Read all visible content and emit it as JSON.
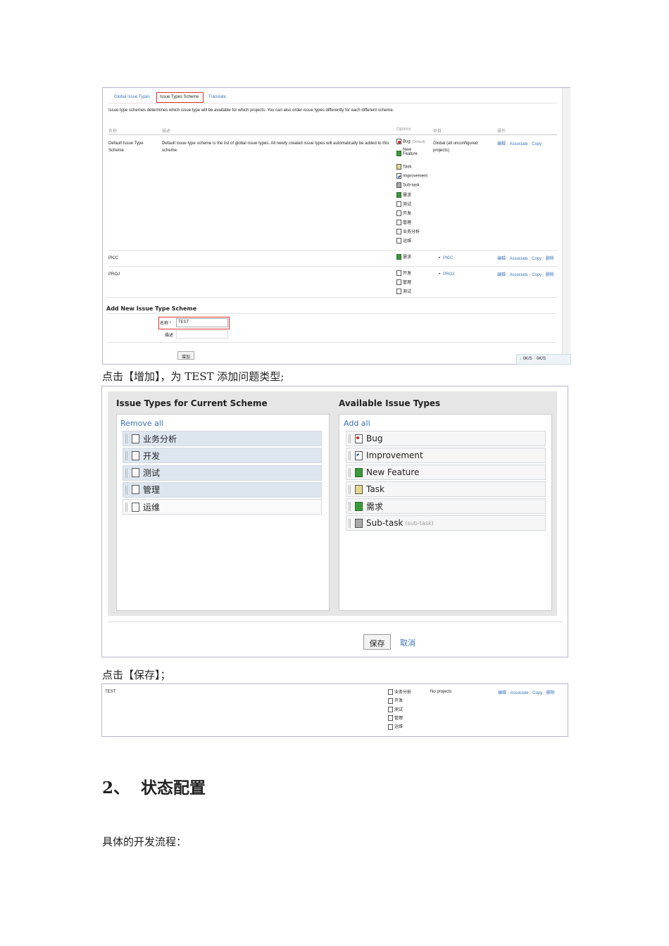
{
  "shot1": {
    "tabs": [
      "Global Issue Types",
      "Issue Types Scheme",
      "Translate"
    ],
    "description": "Issue type schemes determines which issue type will be available for which projects. You can also order issue types differently for each different scheme.",
    "headers": [
      "名称",
      "描述",
      "Options",
      "项目",
      "操作"
    ],
    "rows": [
      {
        "name": "Default Issue Type Scheme",
        "desc": "Default issue type scheme is the list of global issue types. All newly created issue types will automatically be added to this scheme.",
        "options": [
          {
            "icon": "bug",
            "label": "Bug",
            "note": "(Default)"
          },
          {
            "icon": "feat",
            "label": "New Feature"
          },
          {
            "icon": "task",
            "label": "Task"
          },
          {
            "icon": "imp",
            "label": "Improvement"
          },
          {
            "icon": "sub",
            "label": "Sub-task"
          },
          {
            "icon": "feat",
            "label": "需求"
          },
          {
            "icon": "gen",
            "label": "测试"
          },
          {
            "icon": "gen",
            "label": "开发"
          },
          {
            "icon": "gen",
            "label": "管理"
          },
          {
            "icon": "gen",
            "label": "业务分析"
          },
          {
            "icon": "gen",
            "label": "运维"
          }
        ],
        "project": "Global (all unconfigured projects)",
        "actions": [
          "编辑",
          "Associate",
          "Copy"
        ]
      },
      {
        "name": "PICC",
        "desc": "",
        "options": [
          {
            "icon": "feat",
            "label": "需求"
          }
        ],
        "project": "PICC",
        "actions": [
          "编辑",
          "Associate",
          "Copy",
          "删除"
        ]
      },
      {
        "name": "PROJ",
        "desc": "",
        "options": [
          {
            "icon": "gen",
            "label": "开发"
          },
          {
            "icon": "gen",
            "label": "管理"
          },
          {
            "icon": "gen",
            "label": "测试"
          }
        ],
        "project": "PROJ",
        "actions": [
          "编辑",
          "Associate",
          "Copy",
          "删除"
        ]
      }
    ],
    "add_title": "Add New Issue Type Scheme",
    "name_label": "名称 *",
    "name_value": "TEST",
    "desc_label": "描述",
    "add_button": "增加",
    "status": {
      "down": "0K/S",
      "up": "0K/S"
    }
  },
  "caption1": "点击【增加】，为 TEST 添加问题类型;",
  "shot2": {
    "left_title": "Issue Types for Current Scheme",
    "right_title": "Available Issue Types",
    "remove_all": "Remove all",
    "add_all": "Add all",
    "left_items": [
      "业务分析",
      "开发",
      "测试",
      "管理",
      "运维"
    ],
    "right_items": [
      {
        "icon": "bug",
        "label": "Bug",
        "note": ""
      },
      {
        "icon": "imp",
        "label": "Improvement",
        "note": ""
      },
      {
        "icon": "feat",
        "label": "New Feature",
        "note": ""
      },
      {
        "icon": "task",
        "label": "Task",
        "note": ""
      },
      {
        "icon": "feat",
        "label": "需求",
        "note": ""
      },
      {
        "icon": "sub",
        "label": "Sub-task",
        "note": "(sub-task)"
      }
    ],
    "save": "保存",
    "cancel": "取消"
  },
  "caption2": "点击【保存】；",
  "shot3": {
    "name": "TEST",
    "options": [
      "业务分析",
      "开发",
      "测试",
      "管理",
      "运维"
    ],
    "project": "No projects",
    "actions": [
      "编辑",
      "Associate",
      "Copy",
      "删除"
    ]
  },
  "heading": "2、  状态配置",
  "body_text": "具体的开发流程："
}
